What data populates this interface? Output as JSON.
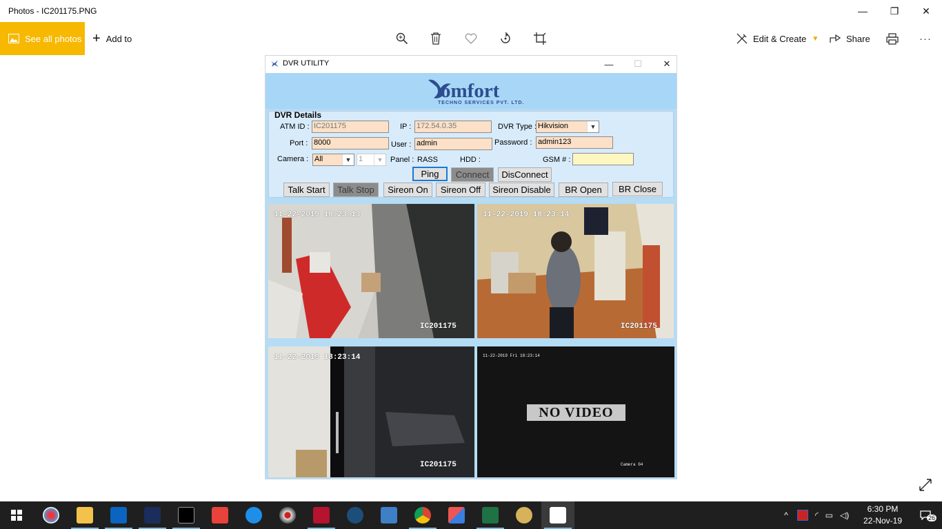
{
  "app": {
    "title": "Photos - IC201175.PNG",
    "minimize": "—",
    "restore": "❐",
    "close": "✕"
  },
  "toolbar": {
    "see_all_photos": "See all photos",
    "add_to": "Add to",
    "edit_create": "Edit & Create",
    "share": "Share",
    "more": "···",
    "icons": [
      "zoom-icon",
      "delete-icon",
      "favorite-icon",
      "rotate-icon",
      "crop-icon",
      "print-icon"
    ]
  },
  "dvr": {
    "window_title": "DVR UTILITY",
    "logo": {
      "brand": "omfort",
      "tagline": "TECHNO SERVICES PVT. LTD."
    },
    "details_title": "DVR Details",
    "labels": {
      "atm_id": "ATM ID :",
      "ip": "IP :",
      "dvr_type": "DVR Type :",
      "port": "Port :",
      "user": "User :",
      "password": "Password :",
      "camera": "Camera :",
      "panel": "Panel :",
      "panel_value": "RASS",
      "hdd": "HDD :",
      "gsm": "GSM # :"
    },
    "values": {
      "atm_id": "IC201175",
      "ip": "172.54.0.35",
      "dvr_type": "Hikvision",
      "port": "8000",
      "user": "admin",
      "password": "admin123",
      "camera": "All",
      "camera_num": "1",
      "gsm": ""
    },
    "buttons": {
      "ping": "Ping",
      "connect": "Connect",
      "disconnect": "DisConnect",
      "talk_start": "Talk Start",
      "talk_stop": "Talk Stop",
      "sireon_on": "Sireon On",
      "sireon_off": "Sireon Off",
      "sireon_disable": "Sireon Disable",
      "br_open": "BR Open",
      "br_close": "BR Close"
    },
    "cameras": [
      {
        "timestamp": "11-22-2019 18:23:13",
        "label": "IC201175"
      },
      {
        "timestamp": "11-22-2019 18:23:14",
        "label": "IC201175"
      },
      {
        "timestamp": "11-22-2019 18:23:14",
        "label": "IC201175"
      },
      {
        "timestamp": "11-22-2019 Fri 18:23:14",
        "label": "Camera 04",
        "status": "NO VIDEO"
      }
    ]
  },
  "taskbar": {
    "clock_time": "6:30 PM",
    "clock_date": "22-Nov-19",
    "notification_count": "26",
    "apps": [
      "paint-app",
      "file-explorer",
      "outlook",
      "comfort-app",
      "command-prompt",
      "anydesk",
      "internet-explorer",
      "eye-app",
      "app-16",
      "network-app",
      "desktop-app",
      "chrome",
      "app-box",
      "excel",
      "paint3d",
      "photos"
    ]
  }
}
